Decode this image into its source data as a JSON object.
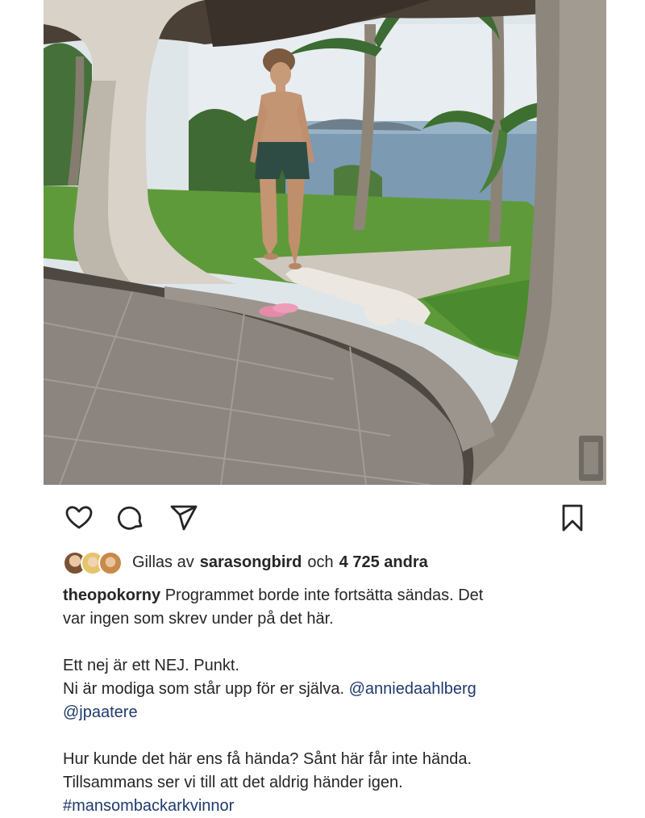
{
  "post": {
    "username": "theopokorny",
    "photo_alt": "Man in swim shorts walking on grass near the sea under a thatched terrace with palm trees"
  },
  "actions": {
    "like_icon": "heart-icon",
    "comment_icon": "comment-icon",
    "share_icon": "paper-plane-icon",
    "save_icon": "bookmark-icon"
  },
  "likes": {
    "prefix": "Gillas av",
    "user": "sarasongbird",
    "conj": "och",
    "others": "4 725 andra"
  },
  "caption": {
    "line1": "Programmet borde inte fortsätta sändas. Det",
    "line2": "var ingen som skrev under på det här.",
    "line3": "Ett nej är ett NEJ. Punkt.",
    "line4": "Ni är modiga som står upp för er själva.",
    "mention1": "@anniedaahlberg",
    "mention2": "@jpaatere",
    "line5": "Hur kunde det här ens få hända? Sånt här får inte hända.",
    "line6": "Tillsammans ser vi till att det aldrig händer igen.",
    "hashtag": "#mansombackarkvinnor"
  },
  "colors": {
    "text": "#262626",
    "link": "#1f3a6e",
    "background": "#ffffff"
  }
}
